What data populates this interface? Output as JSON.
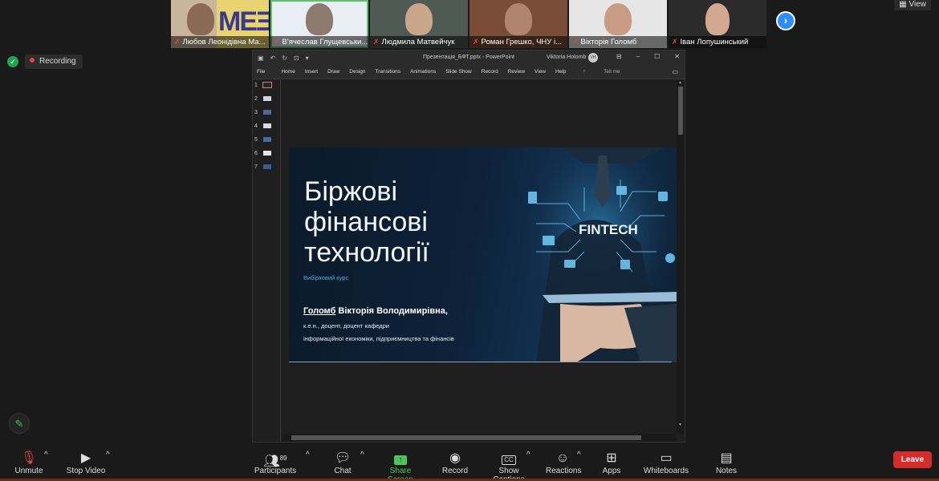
{
  "participants": [
    {
      "name": "Любов Леонідівна Ма..."
    },
    {
      "name": "В'ячеслав Глущевськи..."
    },
    {
      "name": "Людмила Матвейчук"
    },
    {
      "name": "Роман Грешко, ЧНУ і..."
    },
    {
      "name": "Вікторія Голомб"
    },
    {
      "name": "Іван Лопушинський"
    }
  ],
  "view_label": "View",
  "recording_label": "Recording",
  "powerpoint": {
    "file_title": "Презентація_БФТ.pptx  -  PowerPoint",
    "user": "Viktoria Holomb",
    "avatar_initials": "VH",
    "tabs": [
      "File",
      "Home",
      "Insert",
      "Draw",
      "Design",
      "Transitions",
      "Animations",
      "Slide Show",
      "Record",
      "Review",
      "View",
      "Help"
    ],
    "tell_me": "Tell me",
    "thumb_numbers": [
      "1",
      "2",
      "3",
      "4",
      "5",
      "6",
      "7"
    ]
  },
  "slide": {
    "title": "Біржові фінансові технології",
    "subtitle": "Вибірковий курс",
    "author_surname": "Голомб",
    "author_rest": " Вікторія Володимирівна,",
    "line1": "к.е.н., доцент, доцент кафедри",
    "line2": "інформаційної економіки, підприємництва та фінансів",
    "image_text": "FINTECH"
  },
  "toolbar": {
    "unmute": "Unmute",
    "stop_video": "Stop Video",
    "participants": "Participants",
    "participants_count": "89",
    "chat": "Chat",
    "share_screen": "Share Screen",
    "record": "Record",
    "show_captions": "Show Captions",
    "captions_icon": "CC",
    "reactions": "Reactions",
    "apps": "Apps",
    "whiteboards": "Whiteboards",
    "notes": "Notes",
    "leave": "Leave"
  },
  "colors": {
    "accent_green": "#4fc35b",
    "leave_red": "#d42b2b",
    "zoom_blue": "#2d8cff",
    "slide_blue": "#5aa6d4"
  }
}
